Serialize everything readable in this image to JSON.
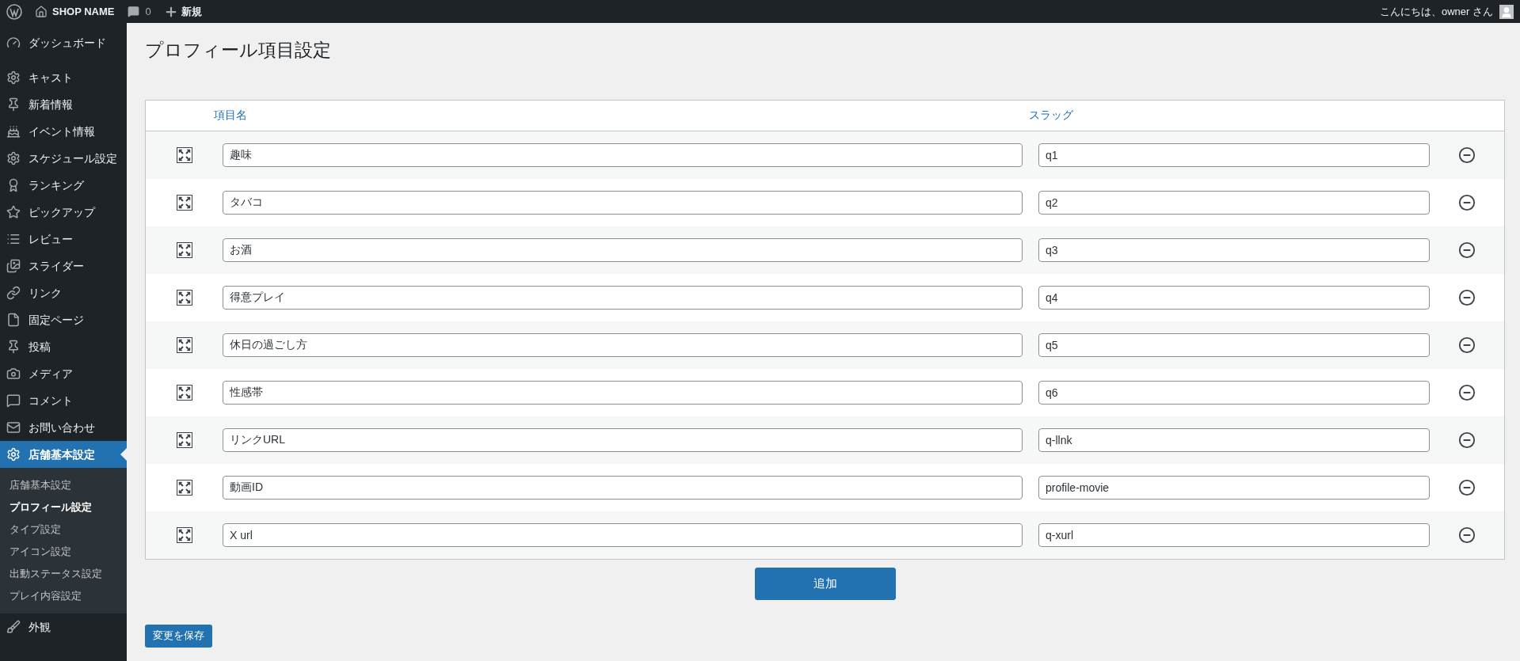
{
  "admin_bar": {
    "site_name": "SHOP NAME",
    "comments_count": "0",
    "new_label": "新規",
    "greeting": "こんにちは、owner さん"
  },
  "sidebar": {
    "items": [
      {
        "label": "ダッシュボード",
        "selected": false
      },
      {
        "label": "キャスト",
        "selected": false
      },
      {
        "label": "新着情報",
        "selected": false
      },
      {
        "label": "イベント情報",
        "selected": false
      },
      {
        "label": "スケジュール設定",
        "selected": false
      },
      {
        "label": "ランキング",
        "selected": false
      },
      {
        "label": "ピックアップ",
        "selected": false
      },
      {
        "label": "レビュー",
        "selected": false
      },
      {
        "label": "スライダー",
        "selected": false
      },
      {
        "label": "リンク",
        "selected": false
      },
      {
        "label": "固定ページ",
        "selected": false
      },
      {
        "label": "投稿",
        "selected": false
      },
      {
        "label": "メディア",
        "selected": false
      },
      {
        "label": "コメント",
        "selected": false
      },
      {
        "label": "お問い合わせ",
        "selected": false
      },
      {
        "label": "店舗基本設定",
        "selected": true,
        "children": [
          {
            "label": "店舗基本設定",
            "selected": false
          },
          {
            "label": "プロフィール設定",
            "selected": true
          },
          {
            "label": "タイプ設定",
            "selected": false
          },
          {
            "label": "アイコン設定",
            "selected": false
          },
          {
            "label": "出動ステータス設定",
            "selected": false
          },
          {
            "label": "プレイ内容設定",
            "selected": false
          }
        ]
      },
      {
        "label": "外観",
        "selected": false
      }
    ]
  },
  "page_title": "プロフィール項目設定",
  "table": {
    "columns": [
      "項目名",
      "スラッグ"
    ],
    "rows": [
      {
        "name": "趣味",
        "slug": "q1"
      },
      {
        "name": "タバコ",
        "slug": "q2"
      },
      {
        "name": "お酒",
        "slug": "q3"
      },
      {
        "name": "得意プレイ",
        "slug": "q4"
      },
      {
        "name": "休日の過ごし方",
        "slug": "q5"
      },
      {
        "name": "性感帯",
        "slug": "q6"
      },
      {
        "name": "リンクURL",
        "slug": "q-llnk"
      },
      {
        "name": "動画ID",
        "slug": "profile-movie"
      },
      {
        "name": "X url",
        "slug": "q-xurl"
      }
    ]
  },
  "add_button": "追加",
  "save_button": "変更を保存"
}
